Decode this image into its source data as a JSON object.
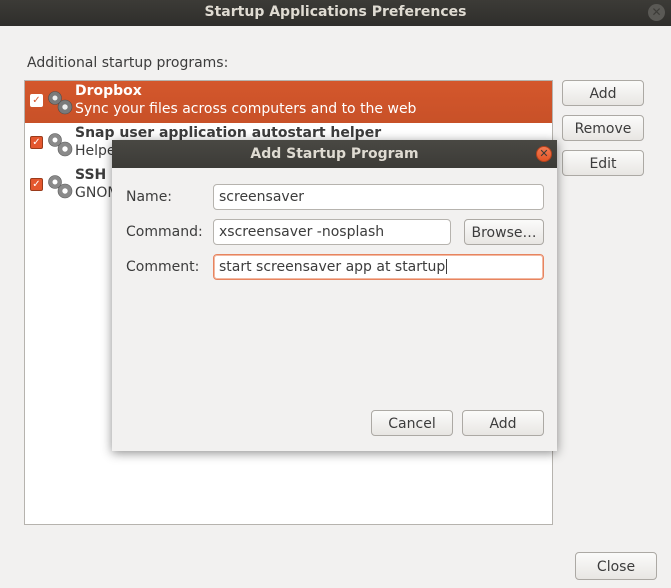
{
  "window": {
    "title": "Startup Applications Preferences",
    "section_label": "Additional startup programs:",
    "programs": [
      {
        "name": "Dropbox",
        "description": "Sync your files across computers and to the web",
        "checked": true,
        "selected": true
      },
      {
        "name": "Snap user application autostart helper",
        "description": "Helper",
        "checked": true,
        "selected": false
      },
      {
        "name": "SSH K",
        "description": "GNOM",
        "checked": true,
        "selected": false
      }
    ],
    "buttons": {
      "add": "Add",
      "remove": "Remove",
      "edit": "Edit",
      "close": "Close"
    }
  },
  "dialog": {
    "title": "Add Startup Program",
    "name_label": "Name:",
    "name_value": "screensaver",
    "command_label": "Command:",
    "command_value": "xscreensaver -nosplash",
    "browse_label": "Browse…",
    "comment_label": "Comment:",
    "comment_value": "start screensaver app at startup",
    "cancel_label": "Cancel",
    "add_label": "Add"
  },
  "colors": {
    "accent": "#dd5a2d",
    "titlebar": "#3c3b37",
    "window_bg": "#f2f1f0"
  },
  "icons": {
    "program": "gear-icon",
    "checkbox": "checkmark-icon",
    "close": "close-icon"
  }
}
